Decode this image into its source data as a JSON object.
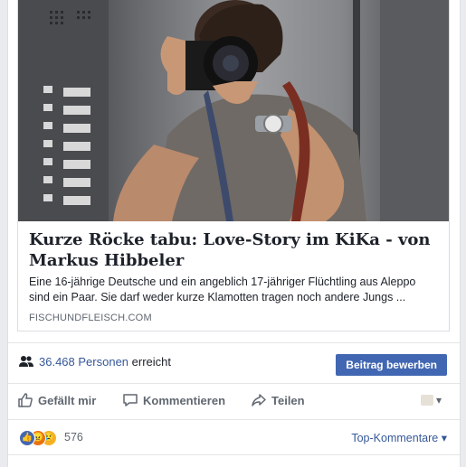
{
  "link": {
    "title": "Kurze Röcke tabu: Love-Story im KiKa - von Markus Hibbeler",
    "description": "Eine 16-jährige Deutsche und ein angeblich 17-jähriger Flüchtling aus Aleppo sind ein Paar. Sie darf weder kurze Klamotten tragen noch andere Jungs ...",
    "domain": "FISCHUNDFLEISCH.COM"
  },
  "reach": {
    "count": "36.468",
    "people_label": "Personen",
    "reached_label": "erreicht",
    "promote_button": "Beitrag bewerben"
  },
  "actions": {
    "like": "Gefällt mir",
    "comment": "Kommentieren",
    "share": "Teilen"
  },
  "reactions": {
    "count": "576",
    "icons": [
      "like-icon",
      "angry-icon",
      "sad-icon"
    ],
    "sort_label": "Top-Kommentare"
  },
  "colors": {
    "brand_blue": "#4267b2",
    "link_blue": "#365899",
    "meta_gray": "#606770"
  }
}
